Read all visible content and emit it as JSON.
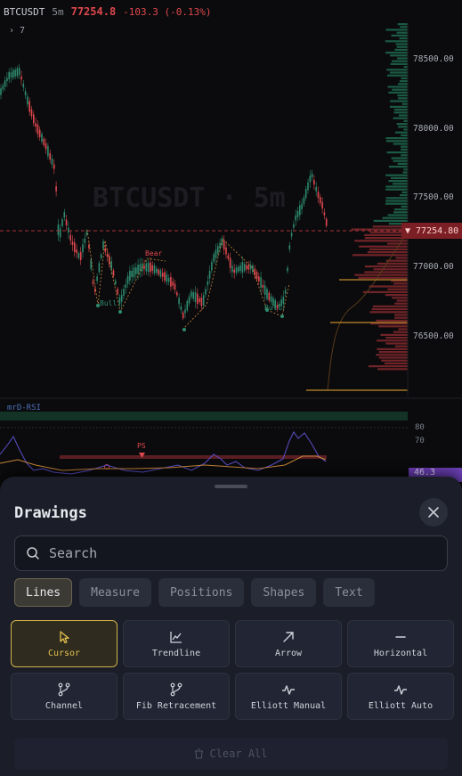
{
  "chart_header": {
    "symbol": "BTCUSDT",
    "timeframe": "5m",
    "last_price": "77254.8",
    "change": "-103.3 (-0.13%)",
    "indicator_toggle": "› 7"
  },
  "chart": {
    "watermark": "BTCUSDT · 5m",
    "price_axis": [
      "78500.00",
      "78000.00",
      "77500.00",
      "77000.00",
      "76500.00"
    ],
    "current_price_tag": "▼ 77254.80",
    "pattern_labels": [
      "Bull",
      "Bear",
      "Bull"
    ],
    "rsi_panel": {
      "title": "mrD-RSI",
      "levels": [
        "80",
        "70"
      ],
      "marker_label": "PS",
      "value": "46.3"
    }
  },
  "sheet": {
    "title": "Drawings",
    "search_placeholder": "Search",
    "tabs": [
      "Lines",
      "Measure",
      "Positions",
      "Shapes",
      "Text"
    ],
    "active_tab": "Lines",
    "tools": [
      {
        "label": "Cursor",
        "icon": "cursor-icon"
      },
      {
        "label": "Trendline",
        "icon": "trendline-icon"
      },
      {
        "label": "Arrow",
        "icon": "arrow-icon"
      },
      {
        "label": "Horizontal",
        "icon": "horizontal-icon"
      },
      {
        "label": "Channel",
        "icon": "channel-icon"
      },
      {
        "label": "Fib Retracement",
        "icon": "fib-icon"
      },
      {
        "label": "Elliott Manual",
        "icon": "elliott-manual-icon"
      },
      {
        "label": "Elliott Auto",
        "icon": "elliott-auto-icon"
      }
    ],
    "active_tool": "Cursor",
    "clear_all": "Clear All"
  },
  "colors": {
    "accent": "#d6b34a",
    "down": "#e0484e",
    "up": "#2e8b6f",
    "rsi": "#6b3fb5",
    "sheet_bg": "#1b1d28"
  }
}
